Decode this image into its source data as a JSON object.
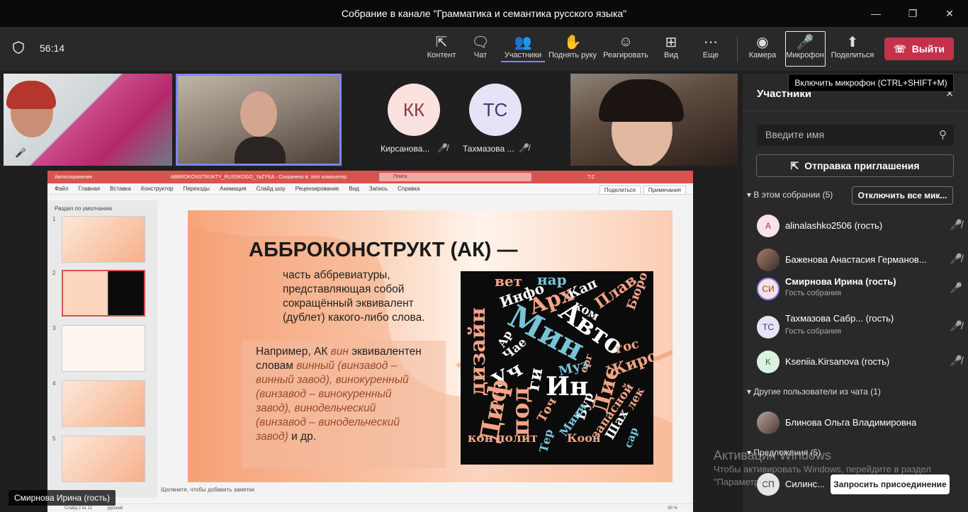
{
  "window": {
    "title": "Собрание в канале \"Грамматика и семантика русского языка\""
  },
  "toolbar": {
    "timer": "56:14",
    "items": [
      {
        "label": "Контент",
        "icon": "share-content-icon"
      },
      {
        "label": "Чат",
        "icon": "chat-icon"
      },
      {
        "label": "Участники",
        "icon": "participants-icon"
      },
      {
        "label": "Поднять руку",
        "icon": "raise-hand-icon"
      },
      {
        "label": "Реагировать",
        "icon": "react-icon"
      },
      {
        "label": "Вид",
        "icon": "grid-view-icon"
      },
      {
        "label": "Еще",
        "icon": "more-icon"
      },
      {
        "label": "Камера",
        "icon": "camera-icon"
      },
      {
        "label": "Микрофон",
        "icon": "mic-off-icon"
      },
      {
        "label": "Поделиться",
        "icon": "share-icon"
      }
    ],
    "leave_label": "Выйти",
    "tooltip": "Включить микрофон (CTRL+SHIFT+M)"
  },
  "video": {
    "tiles": [
      {
        "initials": "КК",
        "name": "Кирсанова..."
      },
      {
        "initials": "ТС",
        "name": "Тахмазова ..."
      }
    ],
    "presenter_tag": "Смирнова Ирина (гость)"
  },
  "ppt": {
    "autosave": "Автосохранение",
    "doc_title": "ABBROKONSTRUKTY_RUSSKOGO_YaZYKA  -  Сохранено в: этот компьютер",
    "search": "Поиск",
    "user": "Т.С",
    "ribbon": [
      "Файл",
      "Главная",
      "Вставка",
      "Конструктор",
      "Переходы",
      "Анимация",
      "Слайд шоу",
      "Рецензирование",
      "Вид",
      "Запись",
      "Справка"
    ],
    "share": "Поделиться",
    "notes_btn": "Примечания",
    "section": "Раздел по умолчанию",
    "notes": "Щелкните, чтобы добавить заметки",
    "status": "Слайд 2 из 12",
    "lang": "русский",
    "zoom": "90 %",
    "slide": {
      "heading": "АББРОКОНСТРУКТ (АК) —",
      "def": "часть аббревиатуры, представляющая собой сокращённый эквивалент (дублет) какого-либо слова.",
      "ex_intro": "Например, АК ",
      "ex_word": "вин",
      "ex_mid": "эквивалентен словам",
      "ex_list": "винный (винзавод – винный завод), винокуренный (винзавод – винокуренный завод), винодельческий (винзавод – винодельческий завод)",
      "ex_end": " и др."
    },
    "wordcloud": [
      "вет",
      "нар",
      "Кап",
      "Инфо",
      "Арх",
      "Плав",
      "Бюро",
      "дизайн",
      "ком",
      "Мин",
      "Авто",
      "гос",
      "Ар",
      "Чае",
      "Жиро",
      "Уч",
      "орг",
      "Муз",
      "Ин",
      "Дис",
      "Диф",
      "под",
      "ги",
      "рес",
      "Точ",
      "лек",
      "Бур",
      "Мини",
      "запасной",
      "Тер",
      "Шах",
      "кон",
      "полит",
      "Коон",
      "сар"
    ]
  },
  "panel": {
    "title": "Участники",
    "search_placeholder": "Введите имя",
    "invite": "Отправка приглашения",
    "in_meeting": "В этом собрании (5)",
    "mute_all": "Отключить все мик...",
    "participants": [
      {
        "initials": "A",
        "name": "alinalashko2506 (гость)",
        "sub": ""
      },
      {
        "initials": "",
        "name": "Баженова Анастасия Германов...",
        "sub": ""
      },
      {
        "initials": "СИ",
        "name": "Смирнова Ирина (гость)",
        "sub": "Гость собрания"
      },
      {
        "initials": "ТС",
        "name": "Тахмазова Сабр... (гость)",
        "sub": "Гость собрания"
      },
      {
        "initials": "K",
        "name": "Kseniia.Kirsanova (гость)",
        "sub": ""
      }
    ],
    "chat_others": "Другие пользователи из чата (1)",
    "chat_user": "Блинова Ольга Владимировна",
    "suggestions": "Предложения (5)",
    "suggest_initials": "СП",
    "suggest_name": "Силинс...",
    "request_join": "Запросить присоединение"
  },
  "watermark": {
    "line1": "Активация Windows",
    "line2": "Чтобы активировать Windows, перейдите в раздел \"Параметры\"."
  },
  "colors": {
    "accent": "#7f85f5",
    "leave": "#c4314b",
    "ppt": "#d9534f"
  }
}
